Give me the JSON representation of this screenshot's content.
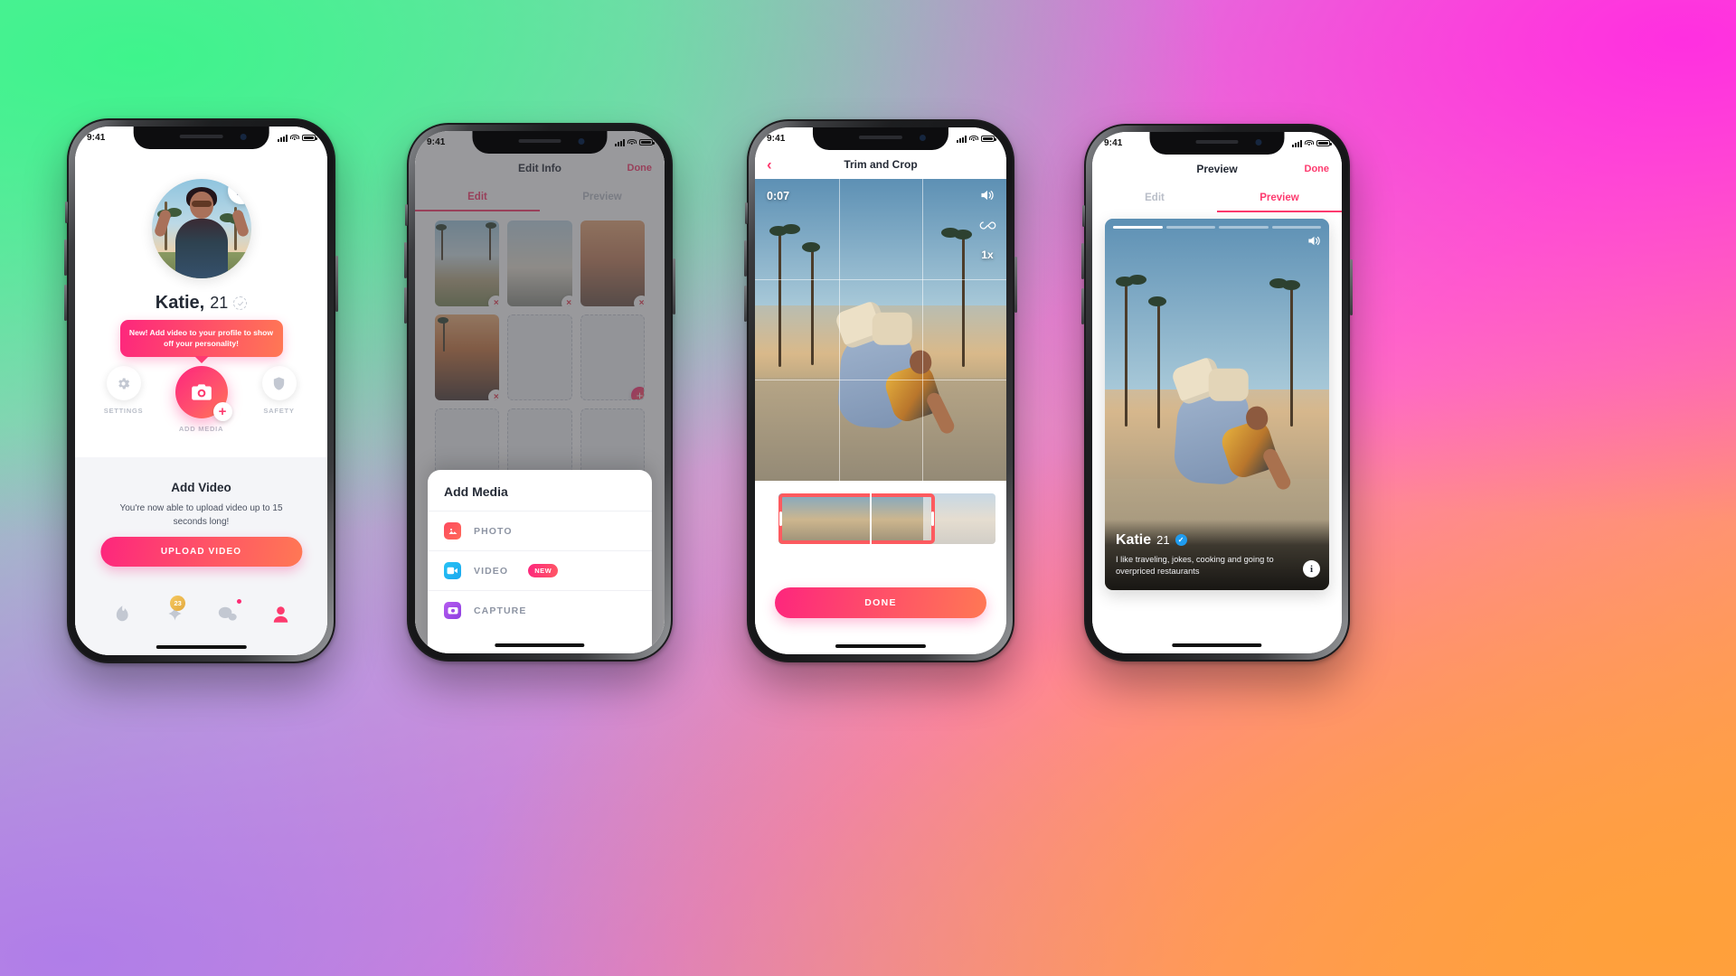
{
  "status_bar": {
    "time": "9:41",
    "signal_icon": "cellular-bars-icon",
    "wifi_icon": "wifi-icon",
    "battery_icon": "battery-icon"
  },
  "phone1": {
    "name": "profile-screen",
    "profile": {
      "first_name": "Katie,",
      "age": "21",
      "edit_icon": "pencil-icon",
      "verify_icon": "verified-dashed-icon"
    },
    "tooltip": "New! Add video to your profile to show off your personality!",
    "actions": [
      {
        "label": "SETTINGS",
        "icon": "gear-icon"
      },
      {
        "label": "ADD MEDIA",
        "icon": "camera-icon",
        "badge_icon": "plus-icon"
      },
      {
        "label": "SAFETY",
        "icon": "shield-icon"
      }
    ],
    "card": {
      "title": "Add Video",
      "subtitle": "You're now able to upload video up to 15 seconds long!",
      "dots_total": 5,
      "dots_active": 1,
      "button": "UPLOAD VIDEO"
    },
    "tabs": [
      {
        "icon": "flame-icon",
        "badge": ""
      },
      {
        "icon": "sparkle-icon",
        "badge": "23"
      },
      {
        "icon": "chat-bubbles-icon",
        "badge": "dot"
      },
      {
        "icon": "profile-person-icon",
        "badge": ""
      }
    ]
  },
  "phone2": {
    "name": "edit-info-screen",
    "nav": {
      "title": "Edit Info",
      "done": "Done"
    },
    "segments": [
      {
        "label": "Edit",
        "active": true
      },
      {
        "label": "Preview",
        "active": false
      }
    ],
    "sheet": {
      "title": "Add Media",
      "items": [
        {
          "label": "PHOTO",
          "icon": "image-icon",
          "badge": ""
        },
        {
          "label": "VIDEO",
          "icon": "video-camera-icon",
          "badge": "NEW"
        },
        {
          "label": "CAPTURE",
          "icon": "capture-camera-icon",
          "badge": ""
        }
      ]
    },
    "grid_remove_icon": "close-x-icon",
    "grid_add_icon": "plus-icon"
  },
  "phone3": {
    "name": "trim-and-crop-screen",
    "nav": {
      "title": "Trim and Crop",
      "back_icon": "chevron-left-icon"
    },
    "video": {
      "timecode": "0:07",
      "controls": [
        {
          "name": "volume-icon",
          "label": "🔊"
        },
        {
          "name": "loop-icon",
          "label": "∞"
        },
        {
          "name": "speed-toggle",
          "label": "1x"
        }
      ]
    },
    "done_button": "DONE"
  },
  "phone4": {
    "name": "preview-screen",
    "nav": {
      "title": "Preview",
      "done": "Done"
    },
    "segments": [
      {
        "label": "Edit",
        "active": false
      },
      {
        "label": "Preview",
        "active": true
      }
    ],
    "card": {
      "name": "Katie",
      "age": "21",
      "verified_icon": "blue-check-icon",
      "bio": "I like traveling, jokes, cooking and going to overpriced restaurants",
      "info_icon": "info-icon",
      "volume_icon": "volume-icon",
      "progress_segments": 4,
      "progress_active": 1
    }
  },
  "colors": {
    "brand_pink": "#fd267d",
    "brand_orange": "#ff7854",
    "blue_tick": "#1f9cf0",
    "gold_badge": "#e3a93f"
  }
}
